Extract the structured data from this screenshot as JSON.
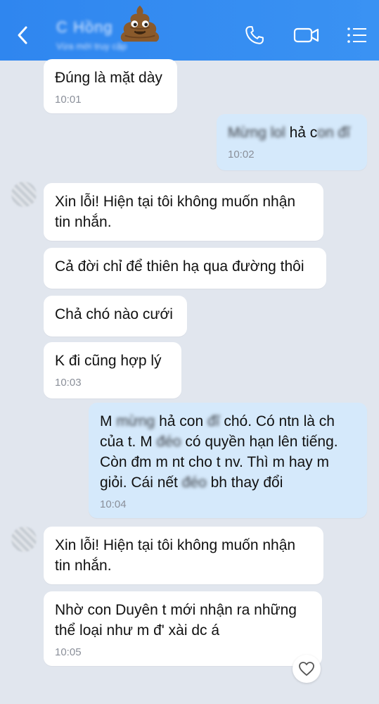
{
  "header": {
    "contact_name": "C Hồng",
    "status": "Vừa mới truy cập",
    "icons": [
      "back-icon",
      "phone-icon",
      "video-icon",
      "menu-icon"
    ],
    "emoji": "poop-emoji",
    "background_color": "#3a8ff2"
  },
  "messages": [
    {
      "sender": "contact",
      "parts": [
        {
          "text": "Đúng là mặt dày"
        }
      ],
      "time": "10:01"
    },
    {
      "sender": "me",
      "parts": [
        {
          "text": "Mừng lol",
          "blur": true
        },
        {
          "text": " hả c"
        },
        {
          "text": "on",
          "blur": true
        },
        {
          "text": " "
        },
        {
          "text": "đĩ",
          "blur": true
        }
      ],
      "time": "10:02"
    },
    {
      "sender": "contact",
      "parts": [
        {
          "text": "Xin lỗi! Hiện tại tôi không muốn nhận\ntin nhắn."
        }
      ],
      "time": ""
    },
    {
      "sender": "contact",
      "parts": [
        {
          "text": "Cả đời chỉ để thiên hạ qua đường thôi"
        }
      ],
      "time": ""
    },
    {
      "sender": "contact",
      "parts": [
        {
          "text": "Chả chó nào cưới"
        }
      ],
      "time": ""
    },
    {
      "sender": "contact",
      "parts": [
        {
          "text": "K đi cũng hợp lý"
        }
      ],
      "time": "10:03"
    },
    {
      "sender": "me",
      "parts": [
        {
          "text": "M "
        },
        {
          "text": "mừng",
          "blur": true
        },
        {
          "text": " hả con "
        },
        {
          "text": "đĩ",
          "blur": true
        },
        {
          "text": " chó. Có ntn là ch\ncủa t. M "
        },
        {
          "text": "đéo",
          "blur": true
        },
        {
          "text": " có quyền hạn lên tiếng.\nCòn đm m nt cho t nv. Thì m hay m\ngiỏi. Cái nết "
        },
        {
          "text": "đéo",
          "blur": true
        },
        {
          "text": " bh thay đổi"
        }
      ],
      "time": "10:04"
    },
    {
      "sender": "contact",
      "parts": [
        {
          "text": "Xin lỗi! Hiện tại tôi không muốn nhận\ntin nhắn."
        }
      ],
      "time": ""
    },
    {
      "sender": "contact",
      "parts": [
        {
          "text": "Nhờ con Duyên t mới nhận ra những\nthể loại như m đ' xài dc á"
        }
      ],
      "time": "10:05"
    }
  ],
  "reaction_icon": "heart-icon"
}
